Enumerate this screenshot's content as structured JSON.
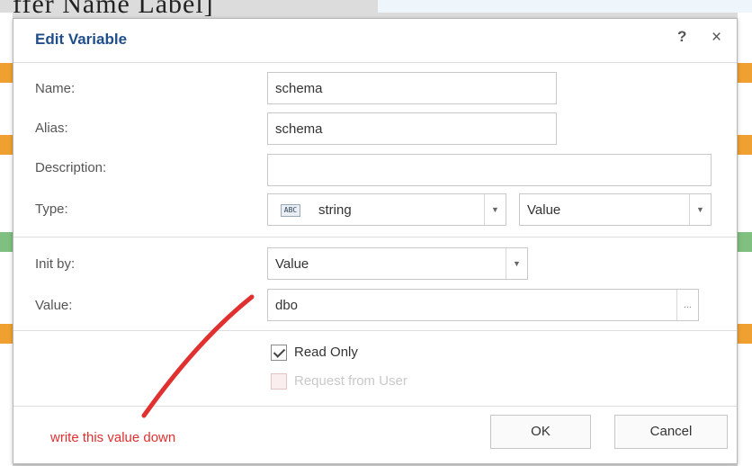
{
  "background": {
    "top_text": "ffer Name Label]",
    "accent_colors": [
      "#f0a030",
      "#7fbf7f"
    ]
  },
  "dialog": {
    "title": "Edit Variable",
    "help_label": "?",
    "close_label": "×",
    "name": {
      "label": "Name:",
      "value": "schema"
    },
    "alias": {
      "label": "Alias:",
      "value": "schema"
    },
    "description": {
      "label": "Description:",
      "value": ""
    },
    "type": {
      "label": "Type:",
      "icon_text": "ABC",
      "icon": "string-type-icon",
      "value": "string",
      "mode": "Value"
    },
    "init_by": {
      "label": "Init by:",
      "value": "Value"
    },
    "value_field": {
      "label": "Value:",
      "value": "dbo",
      "browse_label": "..."
    },
    "read_only": {
      "label": "Read Only",
      "checked": true
    },
    "request_from_user": {
      "label": "Request from User",
      "checked": false,
      "enabled": false
    },
    "ok_label": "OK",
    "cancel_label": "Cancel"
  },
  "annotation": {
    "text": "write this value down",
    "color": "#e03030"
  }
}
